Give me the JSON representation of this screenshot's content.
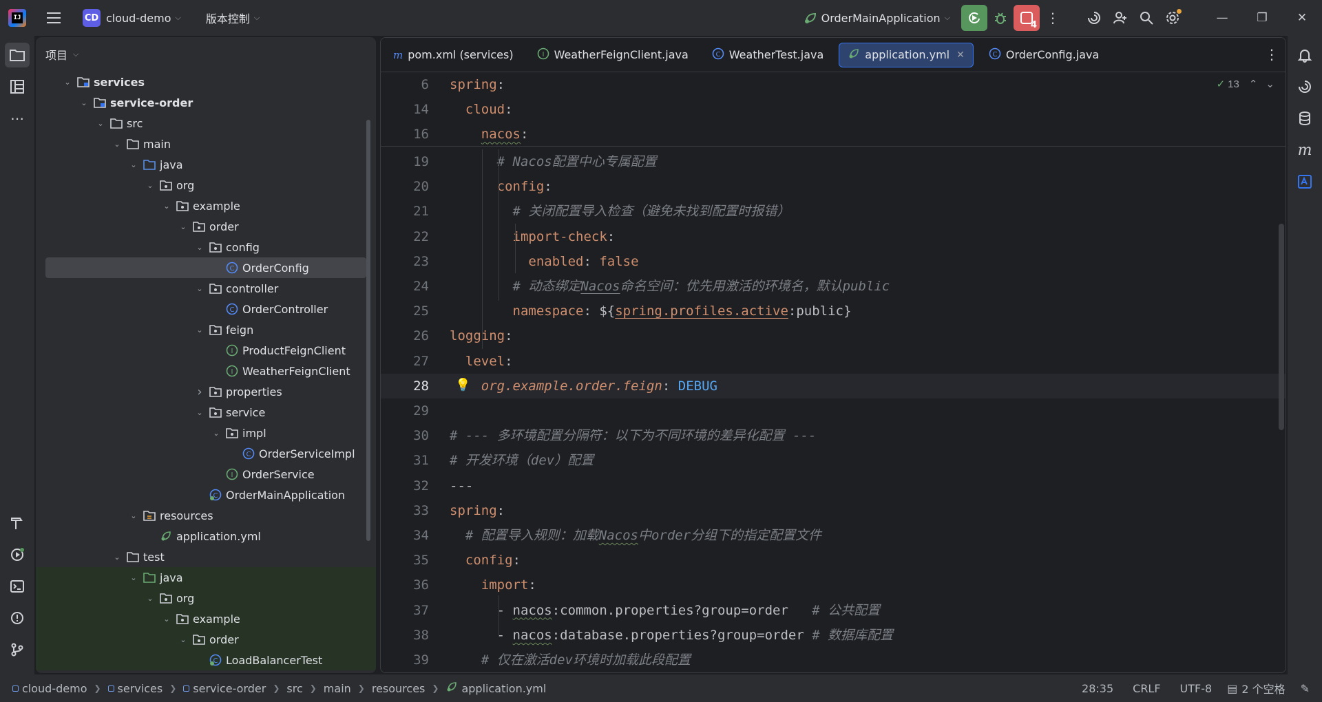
{
  "titlebar": {
    "project_badge": "CD",
    "project_name": "cloud-demo",
    "vcs_label": "版本控制",
    "run_config": "OrderMainApplication",
    "notif_count": "4"
  },
  "project_panel": {
    "title": "项目",
    "tree": [
      {
        "label": "services",
        "depth": 1,
        "kind": "module",
        "open": true,
        "bold": true
      },
      {
        "label": "service-order",
        "depth": 2,
        "kind": "module",
        "open": true,
        "bold": true
      },
      {
        "label": "src",
        "depth": 3,
        "kind": "folder",
        "open": true
      },
      {
        "label": "main",
        "depth": 4,
        "kind": "folder",
        "open": true
      },
      {
        "label": "java",
        "depth": 5,
        "kind": "src-folder",
        "open": true
      },
      {
        "label": "org",
        "depth": 6,
        "kind": "package",
        "open": true
      },
      {
        "label": "example",
        "depth": 7,
        "kind": "package",
        "open": true
      },
      {
        "label": "order",
        "depth": 8,
        "kind": "package",
        "open": true
      },
      {
        "label": "config",
        "depth": 9,
        "kind": "package",
        "open": true
      },
      {
        "label": "OrderConfig",
        "depth": 10,
        "kind": "class",
        "selected": true
      },
      {
        "label": "controller",
        "depth": 9,
        "kind": "package",
        "open": true
      },
      {
        "label": "OrderController",
        "depth": 10,
        "kind": "class"
      },
      {
        "label": "feign",
        "depth": 9,
        "kind": "package",
        "open": true
      },
      {
        "label": "ProductFeignClient",
        "depth": 10,
        "kind": "interface"
      },
      {
        "label": "WeatherFeignClient",
        "depth": 10,
        "kind": "interface"
      },
      {
        "label": "properties",
        "depth": 9,
        "kind": "package",
        "open": false
      },
      {
        "label": "service",
        "depth": 9,
        "kind": "package",
        "open": true
      },
      {
        "label": "impl",
        "depth": 10,
        "kind": "package",
        "open": true
      },
      {
        "label": "OrderServiceImpl",
        "depth": 11,
        "kind": "class"
      },
      {
        "label": "OrderService",
        "depth": 10,
        "kind": "interface"
      },
      {
        "label": "OrderMainApplication",
        "depth": 9,
        "kind": "spring-class"
      },
      {
        "label": "resources",
        "depth": 5,
        "kind": "res-folder",
        "open": true
      },
      {
        "label": "application.yml",
        "depth": 6,
        "kind": "yml"
      },
      {
        "label": "test",
        "depth": 4,
        "kind": "folder",
        "open": true
      },
      {
        "label": "java",
        "depth": 5,
        "kind": "test-folder",
        "open": true,
        "test": true
      },
      {
        "label": "org",
        "depth": 6,
        "kind": "package",
        "open": true,
        "test": true
      },
      {
        "label": "example",
        "depth": 7,
        "kind": "package",
        "open": true,
        "test": true
      },
      {
        "label": "order",
        "depth": 8,
        "kind": "package",
        "open": true,
        "test": true
      },
      {
        "label": "LoadBalancerTest",
        "depth": 9,
        "kind": "spring-class",
        "test": true
      }
    ]
  },
  "editor": {
    "tabs": [
      {
        "label": "pom.xml (services)",
        "icon": "m"
      },
      {
        "label": "WeatherFeignClient.java",
        "icon": "I"
      },
      {
        "label": "WeatherTest.java",
        "icon": "C"
      },
      {
        "label": "application.yml",
        "icon": "yml",
        "active": true
      },
      {
        "label": "OrderConfig.java",
        "icon": "C"
      }
    ],
    "inspection_count": "13",
    "sticky_lines": [
      {
        "n": "6",
        "html": "<span class='k'>spring</span><span class='v'>:</span>"
      },
      {
        "n": "14",
        "html": "  <span class='k'>cloud</span><span class='v'>:</span>"
      },
      {
        "n": "16",
        "html": "    <span class='k ul'>nacos</span><span class='v'>:</span>"
      }
    ],
    "lines": [
      {
        "n": "19",
        "html": "      <span class='c'># Nacos配置中心专属配置</span>"
      },
      {
        "n": "20",
        "html": "      <span class='k'>config</span><span class='v'>:</span>"
      },
      {
        "n": "21",
        "html": "        <span class='c'># 关闭配置导入检查（避免未找到配置时报错）</span>"
      },
      {
        "n": "22",
        "html": "        <span class='k'>import-check</span><span class='v'>:</span>"
      },
      {
        "n": "23",
        "html": "          <span class='k'>enabled</span><span class='v'>: </span><span class='k'>false</span>"
      },
      {
        "n": "24",
        "html": "        <span class='c'># 动态绑定<span class='ul2'>Nacos</span>命名空间：优先用激活的环境名，默认public</span>"
      },
      {
        "n": "25",
        "html": "        <span class='k'>namespace</span><span class='v'>: ${</span><span class='k ul2'>spring.profiles.active</span><span class='v'>:public}</span>"
      },
      {
        "n": "26",
        "html": "<span class='k'>logging</span><span class='v'>:</span>"
      },
      {
        "n": "27",
        "html": "  <span class='k'>level</span><span class='v'>:</span>"
      },
      {
        "n": "28",
        "html": "    <span class='it'>org.example.order.feign</span><span class='v'>: </span><span class='lg'>DEBUG</span>",
        "current": true
      },
      {
        "n": "29",
        "html": ""
      },
      {
        "n": "30",
        "html": "<span class='c'># --- 多环境配置分隔符：以下为不同环境的差异化配置 ---</span>"
      },
      {
        "n": "31",
        "html": "<span class='c'># 开发环境（dev）配置</span>"
      },
      {
        "n": "32",
        "html": "<span class='v'>---</span>"
      },
      {
        "n": "33",
        "html": "<span class='k'>spring</span><span class='v'>:</span>"
      },
      {
        "n": "34",
        "html": "  <span class='c'># 配置导入规则：加载<span class='ul'>Nacos</span>中order分组下的指定配置文件</span>"
      },
      {
        "n": "35",
        "html": "  <span class='k'>config</span><span class='v'>:</span>"
      },
      {
        "n": "36",
        "html": "    <span class='k'>import</span><span class='v'>:</span>"
      },
      {
        "n": "37",
        "html": "      <span class='v'>- <span class='ul'>nacos</span>:common.properties?group=order   </span><span class='c'># 公共配置</span>"
      },
      {
        "n": "38",
        "html": "      <span class='v'>- <span class='ul'>nacos</span>:database.properties?group=order </span><span class='c'># 数据库配置</span>"
      },
      {
        "n": "39",
        "html": "    <span class='c'># 仅在激活dev环境时加载此段配置</span>"
      }
    ]
  },
  "statusbar": {
    "crumbs": [
      "cloud-demo",
      "services",
      "service-order",
      "src",
      "main",
      "resources",
      "application.yml"
    ],
    "position": "28:35",
    "line_sep": "CRLF",
    "encoding": "UTF-8",
    "indent": "2 个空格"
  }
}
